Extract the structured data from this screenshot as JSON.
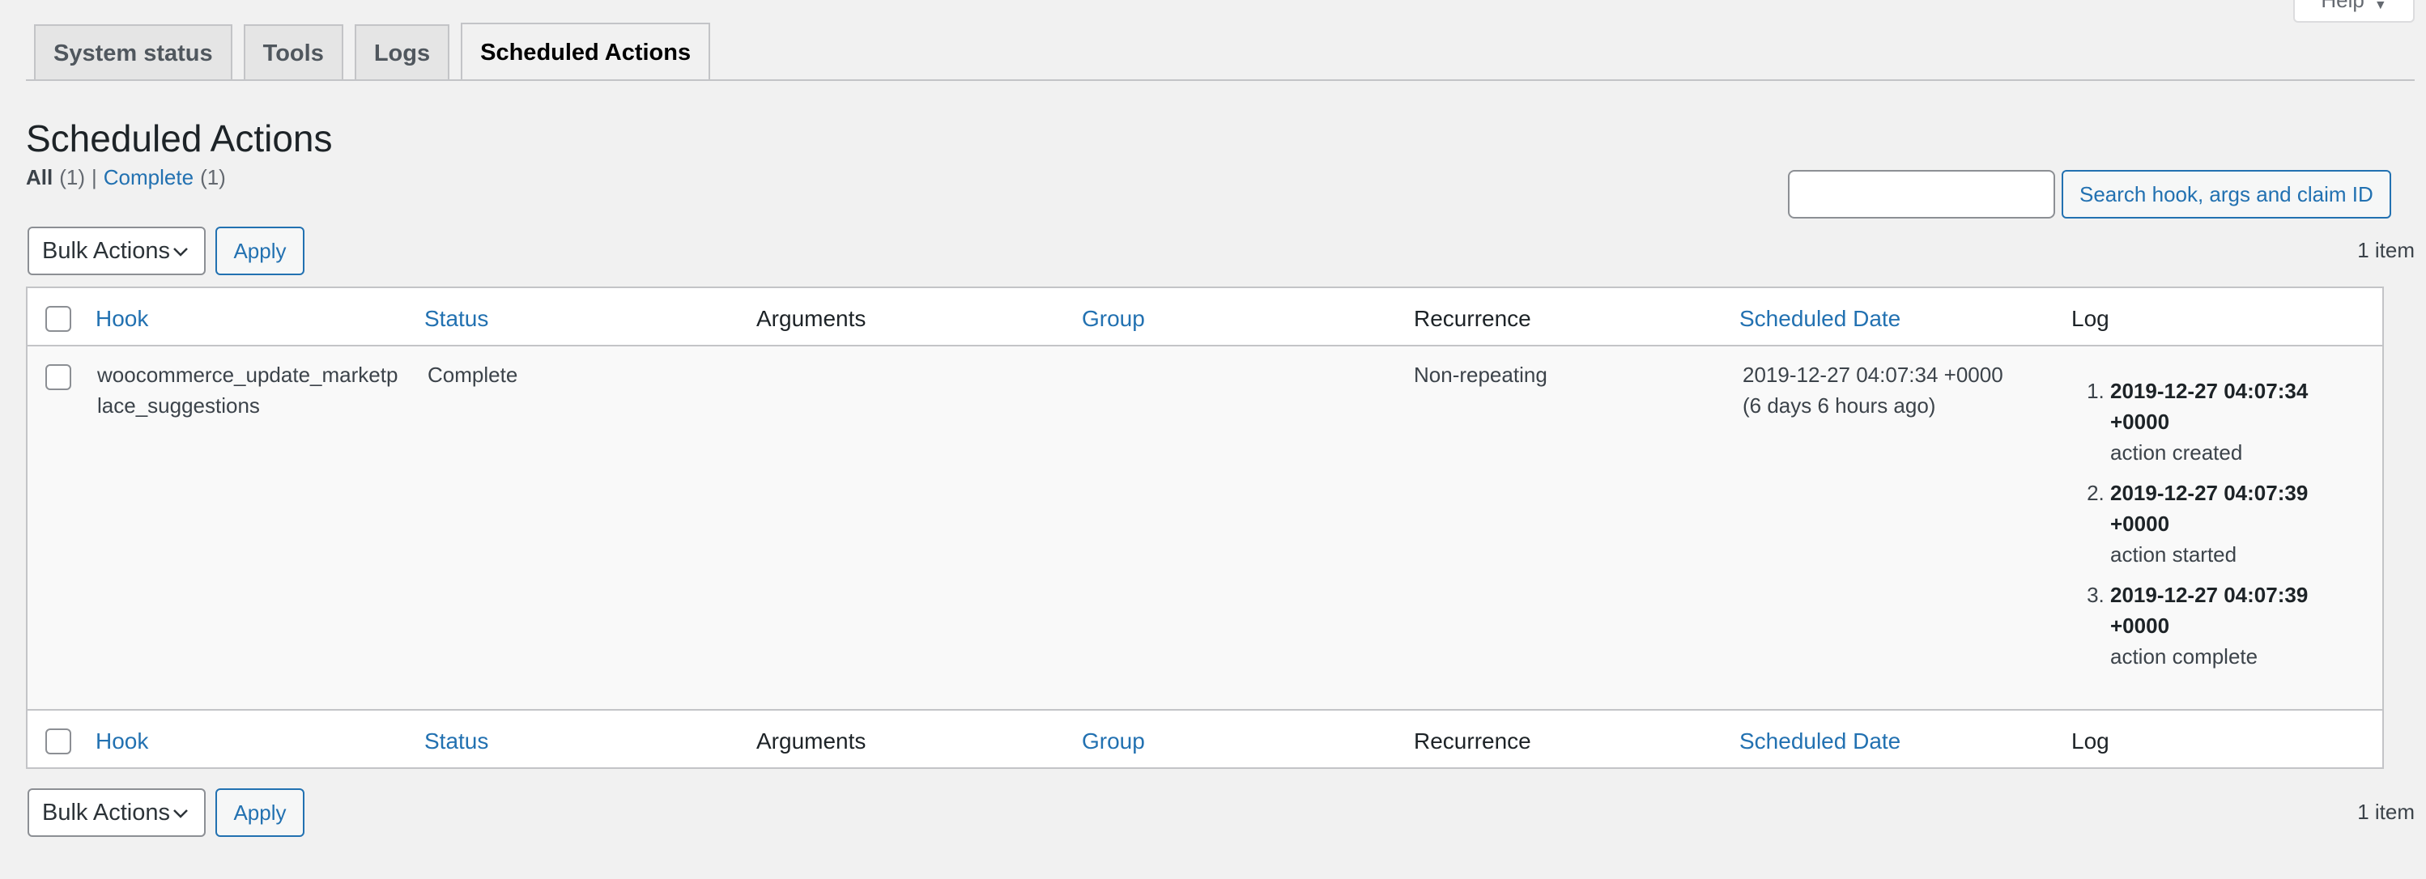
{
  "help": {
    "label": "Help",
    "caret": "▼"
  },
  "tabs": [
    {
      "label": "System status",
      "active": false
    },
    {
      "label": "Tools",
      "active": false
    },
    {
      "label": "Logs",
      "active": false
    },
    {
      "label": "Scheduled Actions",
      "active": true
    }
  ],
  "page": {
    "title": "Scheduled Actions"
  },
  "filters": {
    "all_label": "All",
    "all_count": "(1)",
    "separator": "|",
    "complete_label": "Complete",
    "complete_count": "(1)"
  },
  "search": {
    "value": "",
    "button_label": "Search hook, args and claim ID"
  },
  "tablenav": {
    "bulk_label": "Bulk Actions",
    "apply_label": "Apply",
    "count_label": "1 item"
  },
  "columns": {
    "hook": "Hook",
    "status": "Status",
    "arguments": "Arguments",
    "group": "Group",
    "recurrence": "Recurrence",
    "scheduled_date": "Scheduled Date",
    "log": "Log"
  },
  "rows": [
    {
      "hook_line1": "woocommerce_update_marketp",
      "hook_line2": "lace_suggestions",
      "status": "Complete",
      "arguments": "",
      "group": "",
      "recurrence": "Non-repeating",
      "scheduled_date": "2019-12-27 04:07:34 +0000",
      "scheduled_relative": "(6 days 6 hours ago)",
      "log": [
        {
          "time_line1": "2019-12-27 04:07:34",
          "time_line2": "+0000",
          "message": "action created"
        },
        {
          "time_line1": "2019-12-27 04:07:39",
          "time_line2": "+0000",
          "message": "action started"
        },
        {
          "time_line1": "2019-12-27 04:07:39",
          "time_line2": "+0000",
          "message": "action complete"
        }
      ]
    }
  ],
  "colors": {
    "link": "#2271b1",
    "background": "#f1f1f1",
    "row_alt": "#f9f9f9"
  }
}
